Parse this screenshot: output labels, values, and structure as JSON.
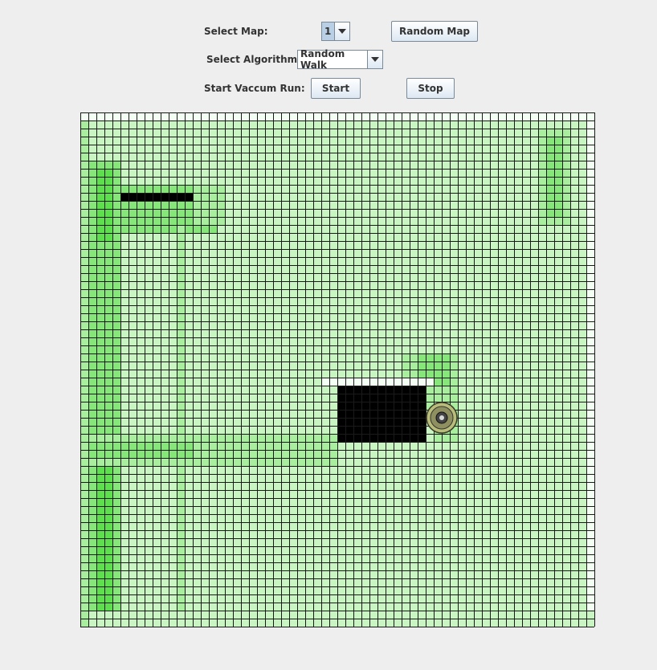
{
  "controls": {
    "select_map_label": "Select Map:",
    "map_value": "1",
    "random_map_label": "Random Map",
    "select_algorithm_label": "Select Algorithm:",
    "algorithm_value": "Random Walk",
    "start_run_label": "Start Vaccum Run:",
    "start_label": "Start",
    "stop_label": "Stop"
  },
  "grid": {
    "cols": 64,
    "rows": 64,
    "colors": {
      "clean": "#f4fff4",
      "light": "#c8f5c2",
      "medium": "#a8ee9e",
      "dark": "#86e67a",
      "darker": "#5ee04e",
      "obstacle": "#000000",
      "gridline": "#1a1a1a"
    },
    "obstacles": [
      {
        "c0": 5,
        "c1": 14,
        "r0": 10,
        "r1": 11
      },
      {
        "c0": 32,
        "c1": 43,
        "r0": 34,
        "r1": 41
      }
    ],
    "robot": {
      "col": 45,
      "row": 38,
      "icon": "robot-vacuum-icon"
    }
  }
}
